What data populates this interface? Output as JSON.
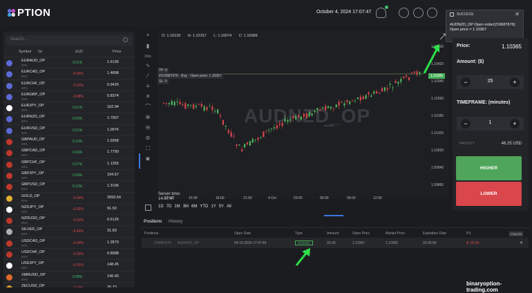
{
  "header": {
    "logo_text": "PTION",
    "datetime": "October 4, 2024 17:07:47"
  },
  "sidebar": {
    "search_placeholder": "Search...",
    "columns": [
      "Symbol",
      "Gr.",
      "Δ1D",
      "Price"
    ],
    "rows": [
      {
        "symbol": "EURAUD_OP",
        "tag": "OP",
        "sub": "80%",
        "change": "0.01%",
        "dir": "up",
        "price": "1.6135",
        "sup": "3",
        "color": "#5c6ad6"
      },
      {
        "symbol": "EURCAD_OP",
        "tag": "OP",
        "sub": "80%",
        "change": "-0.03%",
        "dir": "dn",
        "price": "1.4898",
        "sup": "4",
        "color": "#5c6ad6"
      },
      {
        "symbol": "EURCHF_OP",
        "tag": "OP",
        "sub": "80%",
        "change": "-0.01%",
        "dir": "dn",
        "price": "0.9426",
        "sup": "5",
        "color": "#5c6ad6"
      },
      {
        "symbol": "EURGBP_OP",
        "tag": "OP",
        "sub": "80%",
        "change": "-0.08%",
        "dir": "dn",
        "price": "0.8374",
        "sup": "7",
        "color": "#5c6ad6"
      },
      {
        "symbol": "EURJPY_OP",
        "tag": "OP",
        "sub": "80%",
        "change": "0.01%",
        "dir": "up",
        "price": "162.94",
        "sup": "6",
        "color": "#ffffff"
      },
      {
        "symbol": "EURNZD_OP",
        "tag": "OP",
        "sub": "80%",
        "change": "0.03%",
        "dir": "up",
        "price": "1.7907",
        "sup": "2",
        "color": "#5c6ad6"
      },
      {
        "symbol": "EURUSD_OP",
        "tag": "OP",
        "sub": "80%",
        "change": "0.01%",
        "dir": "up",
        "price": "1.0976",
        "sup": "5",
        "color": "#5c6ad6"
      },
      {
        "symbol": "GBPAUD_OP",
        "tag": "OP",
        "sub": "80%",
        "change": "0.10%",
        "dir": "up",
        "price": "1.9268",
        "sup": "2",
        "color": "#c0392b"
      },
      {
        "symbol": "GBPCAD_OP",
        "tag": "OP",
        "sub": "80%",
        "change": "0.06%",
        "dir": "up",
        "price": "1.7790",
        "sup": "0",
        "color": "#c0392b"
      },
      {
        "symbol": "GBPCHF_OP",
        "tag": "OP",
        "sub": "80%",
        "change": "0.07%",
        "dir": "up",
        "price": "1.1255",
        "sup": "9",
        "color": "#c0392b"
      },
      {
        "symbol": "GBPJPY_OP",
        "tag": "OP",
        "sub": "80%",
        "change": "0.09%",
        "dir": "up",
        "price": "194.57",
        "sup": "0",
        "color": "#c0392b"
      },
      {
        "symbol": "GBPUSD_OP",
        "tag": "OP",
        "sub": "80%",
        "change": "0.10%",
        "dir": "up",
        "price": "1.3106",
        "sup": "9",
        "color": "#c0392b"
      },
      {
        "symbol": "GOLD_OP",
        "tag": "OP",
        "sub": "80%",
        "change": "-0.04%",
        "dir": "dn",
        "price": "2650.64",
        "sup": "",
        "color": "#e0b030"
      },
      {
        "symbol": "NZDJPY_OP",
        "tag": "OP",
        "sub": "80%",
        "change": "-0.02%",
        "dir": "dn",
        "price": "91.50",
        "sup": "0",
        "color": "#ffffff"
      },
      {
        "symbol": "NZDUSD_OP",
        "tag": "OP",
        "sub": "80%",
        "change": "-0.01%",
        "dir": "dn",
        "price": "0.6126",
        "sup": "9",
        "color": "#c0392b"
      },
      {
        "symbol": "SILVER_OP",
        "tag": "OP",
        "sub": "80%",
        "change": "-0.43%",
        "dir": "dn",
        "price": "31.83",
        "sup": "5",
        "color": "#b0b0b0"
      },
      {
        "symbol": "USDCAD_OP",
        "tag": "OP",
        "sub": "80%",
        "change": "-0.04%",
        "dir": "dn",
        "price": "1.3573",
        "sup": "3",
        "color": "#c0392b"
      },
      {
        "symbol": "USDCHF_OP",
        "tag": "OP",
        "sub": "80%",
        "change": "-0.02%",
        "dir": "dn",
        "price": "0.8588",
        "sup": "0",
        "color": "#c0392b"
      },
      {
        "symbol": "USDJPY_OP",
        "tag": "OP",
        "sub": "80%",
        "change": "-0.01%",
        "dir": "dn",
        "price": "148.45",
        "sup": "5",
        "color": "#ffffff"
      },
      {
        "symbol": "XMRUSD_OP",
        "tag": "OP",
        "sub": "80%",
        "change": "0.08%",
        "dir": "up",
        "price": "146.40",
        "sup": "",
        "color": "#e06a2a"
      },
      {
        "symbol": "ZECUSD_OP",
        "tag": "OP",
        "sub": "80%",
        "change": "-0.93%",
        "dir": "dn",
        "price": "26.73",
        "sup": "",
        "color": "#e0a030"
      }
    ]
  },
  "chart": {
    "ohlc": {
      "o": "O: 1.10139",
      "h": "H: 1.10157",
      "l": "L: 1.10074",
      "c": "C: 1.10089"
    },
    "watermark": "AUDNZD_OP",
    "tp_label": "TP: 0",
    "buy_label": "#219687676 · Buy · Open price: 1.10367",
    "sl_label": "SL: 0",
    "current_price": "1.10365",
    "y_ticks": [
      "1.10500",
      "1.10420",
      "1.10340",
      "1.10260",
      "1.10180",
      "1.10100",
      "1.10020",
      "1.09940",
      "1.09860"
    ],
    "x_ticks": [
      "12:00",
      "15:00",
      "18:00",
      "21:00",
      "4 Oct",
      "03:00",
      "06:00",
      "09:00",
      "12:00"
    ],
    "server_time_label": "Server time:",
    "server_time_value": "14:07:47",
    "ranges": [
      "1D",
      "7D",
      "1M",
      "3M",
      "6M",
      "YTD",
      "1Y",
      "5Y",
      "All"
    ],
    "interval": "15m"
  },
  "toast": {
    "title": "SUCCESS",
    "line1": "AUDNZD_OP Open order(219687676):",
    "line2": "Open price = 1.10367"
  },
  "trade_panel": {
    "price_label": "Price:",
    "price_value": "1.10365",
    "amount_label": "Amount: ($)",
    "amount_value": "25",
    "timeframe_label": "TIMEFRAME: (minutes)",
    "timeframe_value": "1",
    "payout_label": "PAYOUT",
    "payout_value": "46.25 USD",
    "higher_label": "HIGHER",
    "lower_label": "LOWER"
  },
  "positions": {
    "tabs": [
      "Positions",
      "History"
    ],
    "headers": [
      "Positions",
      "Open Date",
      "Type",
      "Amount",
      "Open Price",
      "Market Price",
      "Expiration Date",
      "P/L"
    ],
    "close_all": "Close All",
    "row": {
      "id": "219687676",
      "symbol": "AUDNZD_OP",
      "open_date": "04-10-2024 17:07:46",
      "type": "HIGHER",
      "amount": "25.00",
      "open_price": "1.10367",
      "market_price": "1.10365",
      "expiration": "00:00:58",
      "pl": "$ -25.00"
    }
  },
  "watermark_text": "binaryoption-trading.com"
}
